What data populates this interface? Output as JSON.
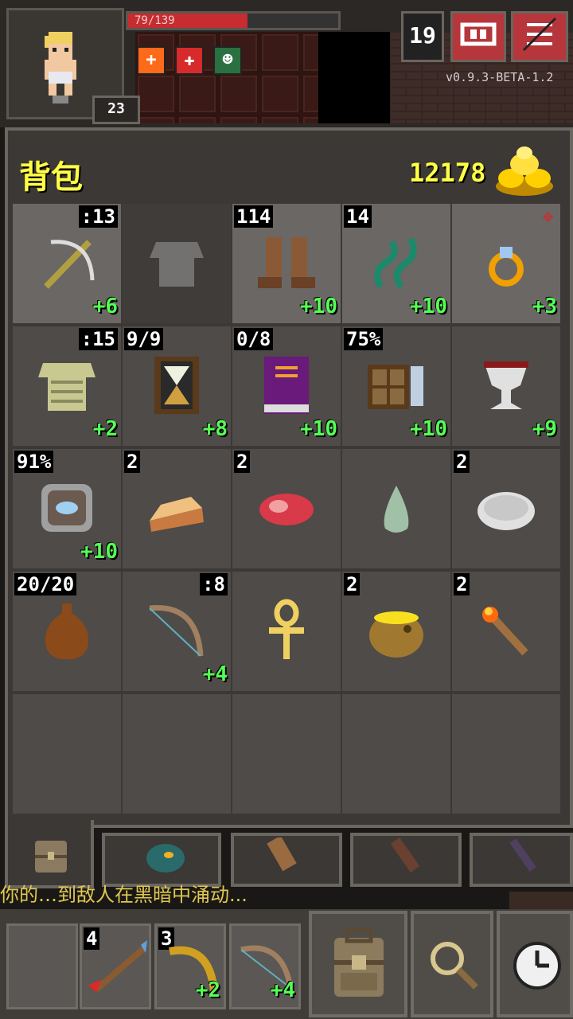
{
  "status": {
    "hp_text": "79/139",
    "hp_fraction": 0.57,
    "level_text": "23",
    "depth": "19",
    "version": "v0.9.3-BETA-1.2",
    "buffs": [
      {
        "icon": "plus-icon",
        "color": "#ff6a1a",
        "glyph": "+"
      },
      {
        "icon": "medkit-icon",
        "color": "#d82a2a",
        "glyph": "✚"
      },
      {
        "icon": "mask-icon",
        "color": "#2a7040",
        "glyph": "☻"
      }
    ],
    "journal_icon": "journal-icon",
    "menu_icon": "menu-icon"
  },
  "bag": {
    "title": "背包",
    "gold": "12178",
    "slots": [
      {
        "name": "crossbow",
        "tl": "",
        "tr": ":13",
        "br": "+6",
        "icon": "crossbow-icon",
        "state": "lit"
      },
      {
        "name": "armor-slot",
        "tl": "",
        "tr": "",
        "br": "",
        "icon": "chainmail-icon",
        "state": "dim"
      },
      {
        "name": "boots",
        "tl": "114",
        "tr": "",
        "br": "+10",
        "icon": "boots-icon",
        "state": "lit"
      },
      {
        "name": "chains",
        "tl": "14",
        "tr": "",
        "br": "+10",
        "icon": "chain-icon",
        "state": "lit"
      },
      {
        "name": "ring",
        "tl": "",
        "tr": "",
        "br": "+3",
        "icon": "ring-icon",
        "state": "lit"
      },
      {
        "name": "scale-armor",
        "tl": "",
        "tr": ":15",
        "br": "+2",
        "icon": "scale-armor-icon",
        "state": ""
      },
      {
        "name": "hourglass",
        "tl": "9/9",
        "tr": "",
        "br": "+8",
        "icon": "hourglass-icon",
        "state": ""
      },
      {
        "name": "spellbook",
        "tl": "0/8",
        "tr": "",
        "br": "+10",
        "icon": "book-icon",
        "state": ""
      },
      {
        "name": "alchemy-kit",
        "tl": "75%",
        "tr": "",
        "br": "+10",
        "icon": "kit-icon",
        "state": ""
      },
      {
        "name": "chalice",
        "tl": "",
        "tr": "",
        "br": "+9",
        "icon": "chalice-icon",
        "state": ""
      },
      {
        "name": "horn",
        "tl": "91%",
        "tr": "",
        "br": "+10",
        "icon": "talisman-icon",
        "state": ""
      },
      {
        "name": "pie",
        "tl": "2",
        "tr": "",
        "br": "",
        "icon": "pie-icon",
        "state": ""
      },
      {
        "name": "meat",
        "tl": "2",
        "tr": "",
        "br": "",
        "icon": "meat-icon",
        "state": ""
      },
      {
        "name": "seed",
        "tl": "",
        "tr": "",
        "br": "",
        "icon": "seed-icon",
        "state": ""
      },
      {
        "name": "stone",
        "tl": "2",
        "tr": "",
        "br": "",
        "icon": "stone-icon",
        "state": ""
      },
      {
        "name": "waterskin",
        "tl": "20/20",
        "tr": "",
        "br": "",
        "icon": "waterskin-icon",
        "state": ""
      },
      {
        "name": "bow",
        "tl": "",
        "tr": ":8",
        "br": "+4",
        "icon": "bow-icon",
        "state": ""
      },
      {
        "name": "ankh",
        "tl": "",
        "tr": "",
        "br": "",
        "icon": "ankh-icon",
        "state": ""
      },
      {
        "name": "honeypot",
        "tl": "2",
        "tr": "",
        "br": "",
        "icon": "honeypot-icon",
        "state": ""
      },
      {
        "name": "torch",
        "tl": "2",
        "tr": "",
        "br": "",
        "icon": "torch-icon",
        "state": ""
      },
      {
        "name": "empty-1",
        "tl": "",
        "tr": "",
        "br": "",
        "icon": "",
        "state": ""
      },
      {
        "name": "empty-2",
        "tl": "",
        "tr": "",
        "br": "",
        "icon": "",
        "state": ""
      },
      {
        "name": "empty-3",
        "tl": "",
        "tr": "",
        "br": "",
        "icon": "",
        "state": ""
      },
      {
        "name": "empty-4",
        "tl": "",
        "tr": "",
        "br": "",
        "icon": "",
        "state": ""
      },
      {
        "name": "empty-5",
        "tl": "",
        "tr": "",
        "br": "",
        "icon": "",
        "state": ""
      }
    ]
  },
  "log": {
    "line": "你的…到敌人在黑暗中涌动..."
  },
  "quickslots": [
    {
      "name": "quickslot-darts",
      "tl": "4",
      "br": "",
      "icon": "dart-icon"
    },
    {
      "name": "quickslot-boomerang",
      "tl": "3",
      "br": "+2",
      "icon": "boomerang-icon"
    },
    {
      "name": "quickslot-bow",
      "tl": "",
      "br": "+4",
      "icon": "bow-icon"
    }
  ],
  "toolbar": {
    "backpack_icon": "backpack-icon",
    "search_icon": "search-icon",
    "wait_icon": "clock-icon"
  }
}
